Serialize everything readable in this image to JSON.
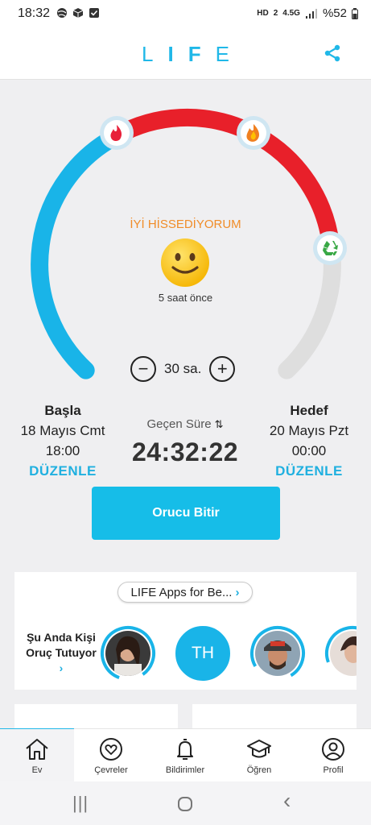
{
  "status_bar": {
    "time": "18:32",
    "hd_badge": "HD",
    "sim": "2",
    "network": "4.5G",
    "battery": "%52"
  },
  "header": {
    "logo_letters": [
      "L",
      "I",
      "F",
      "E"
    ],
    "share_icon": "share-icon"
  },
  "gauge": {
    "feeling_label": "İYİ HİSSEDİYORUM",
    "time_ago": "5 saat önce",
    "progress_fraction": 0.82,
    "colors": {
      "elapsed": "#19b4e8",
      "burn": "#e8202a",
      "remaining": "#dedede"
    },
    "milestone_icons": [
      "flame-icon",
      "fire-icon",
      "recycle-icon"
    ]
  },
  "stepper": {
    "minus": "−",
    "value": "30 sa.",
    "plus": "+"
  },
  "start": {
    "heading": "Başla",
    "date": "18 Mayıs Cmt",
    "time": "18:00",
    "edit_label": "DÜZENLE"
  },
  "elapsed": {
    "label": "Geçen Süre",
    "swap_icon": "⇅",
    "value": "24:32:22"
  },
  "goal": {
    "heading": "Hedef",
    "date": "20 Mayıs Pzt",
    "time": "00:00",
    "edit_label": "DÜZENLE"
  },
  "end_button": {
    "label": "Orucu Bitir"
  },
  "community": {
    "apps_pill": "LIFE Apps for Be...",
    "fasting_now_label": "Şu Anda Kişi Oruç Tutuyor",
    "avatars": [
      {
        "name": "avatar-1",
        "initials": ""
      },
      {
        "name": "avatar-th",
        "initials": "TH"
      },
      {
        "name": "avatar-3",
        "initials": ""
      },
      {
        "name": "avatar-4",
        "initials": ""
      }
    ]
  },
  "tabs": [
    {
      "label": "Ev",
      "icon": "home-icon",
      "active": true
    },
    {
      "label": "Çevreler",
      "icon": "heart-circle-icon",
      "active": false
    },
    {
      "label": "Bildirimler",
      "icon": "bell-icon",
      "active": false
    },
    {
      "label": "Öğren",
      "icon": "graduation-cap-icon",
      "active": false
    },
    {
      "label": "Profil",
      "icon": "profile-icon",
      "active": false
    }
  ],
  "nav_bar": {
    "recents": "|||",
    "home": "○",
    "back": "‹"
  }
}
